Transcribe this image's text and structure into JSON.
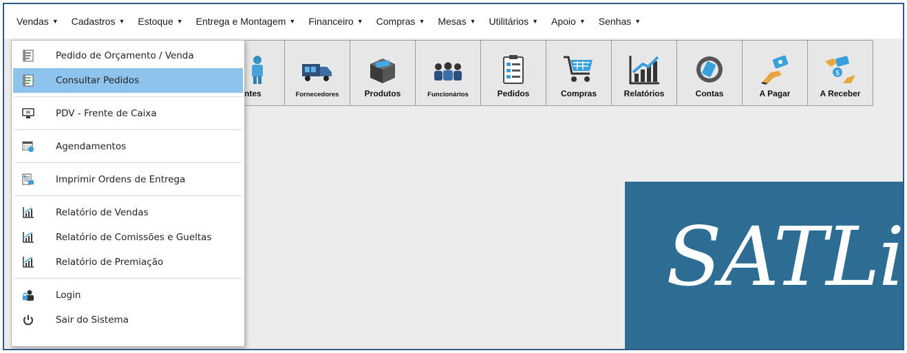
{
  "menubar": {
    "items": [
      {
        "label": "Vendas"
      },
      {
        "label": "Cadastros"
      },
      {
        "label": "Estoque"
      },
      {
        "label": "Entrega e Montagem"
      },
      {
        "label": "Financeiro"
      },
      {
        "label": "Compras"
      },
      {
        "label": "Mesas"
      },
      {
        "label": "Utilitários"
      },
      {
        "label": "Apoio"
      },
      {
        "label": "Senhas"
      }
    ]
  },
  "toolbar": {
    "items": [
      {
        "label": "ntes",
        "icon": "person-icon"
      },
      {
        "label": "Fornecedores",
        "icon": "truck-icon"
      },
      {
        "label": "Produtos",
        "icon": "box-icon"
      },
      {
        "label": "Funcionários",
        "icon": "people-icon"
      },
      {
        "label": "Pedidos",
        "icon": "clipboard-icon"
      },
      {
        "label": "Compras",
        "icon": "cart-icon"
      },
      {
        "label": "Relatórios",
        "icon": "chart-icon"
      },
      {
        "label": "Contas",
        "icon": "coin-icon"
      },
      {
        "label": "A Pagar",
        "icon": "pay-icon"
      },
      {
        "label": "A Receber",
        "icon": "receive-icon"
      }
    ]
  },
  "dropdown": {
    "items": [
      {
        "label": "Pedido de Orçamento / Venda",
        "icon": "order-icon"
      },
      {
        "label": "Consultar Pedidos",
        "icon": "order-search-icon"
      },
      {
        "label": "PDV - Frente de Caixa",
        "icon": "pos-icon"
      },
      {
        "label": "Agendamentos",
        "icon": "calendar-icon"
      },
      {
        "label": "Imprimir Ordens de Entrega",
        "icon": "print-delivery-icon"
      },
      {
        "label": "Relatório de Vendas",
        "icon": "report-chart-icon"
      },
      {
        "label": "Relatório de Comissões e Gueltas",
        "icon": "report-chart-icon"
      },
      {
        "label": "Relatório de Premiação",
        "icon": "report-chart-icon"
      },
      {
        "label": "Login",
        "icon": "login-icon"
      },
      {
        "label": "Sair do Sistema",
        "icon": "power-icon"
      }
    ]
  },
  "logo": {
    "text": "SATLigh"
  },
  "colors": {
    "frame": "#2e5a86",
    "logo_bg": "#2e6d93",
    "menu_highlight": "#8ec3ee"
  }
}
